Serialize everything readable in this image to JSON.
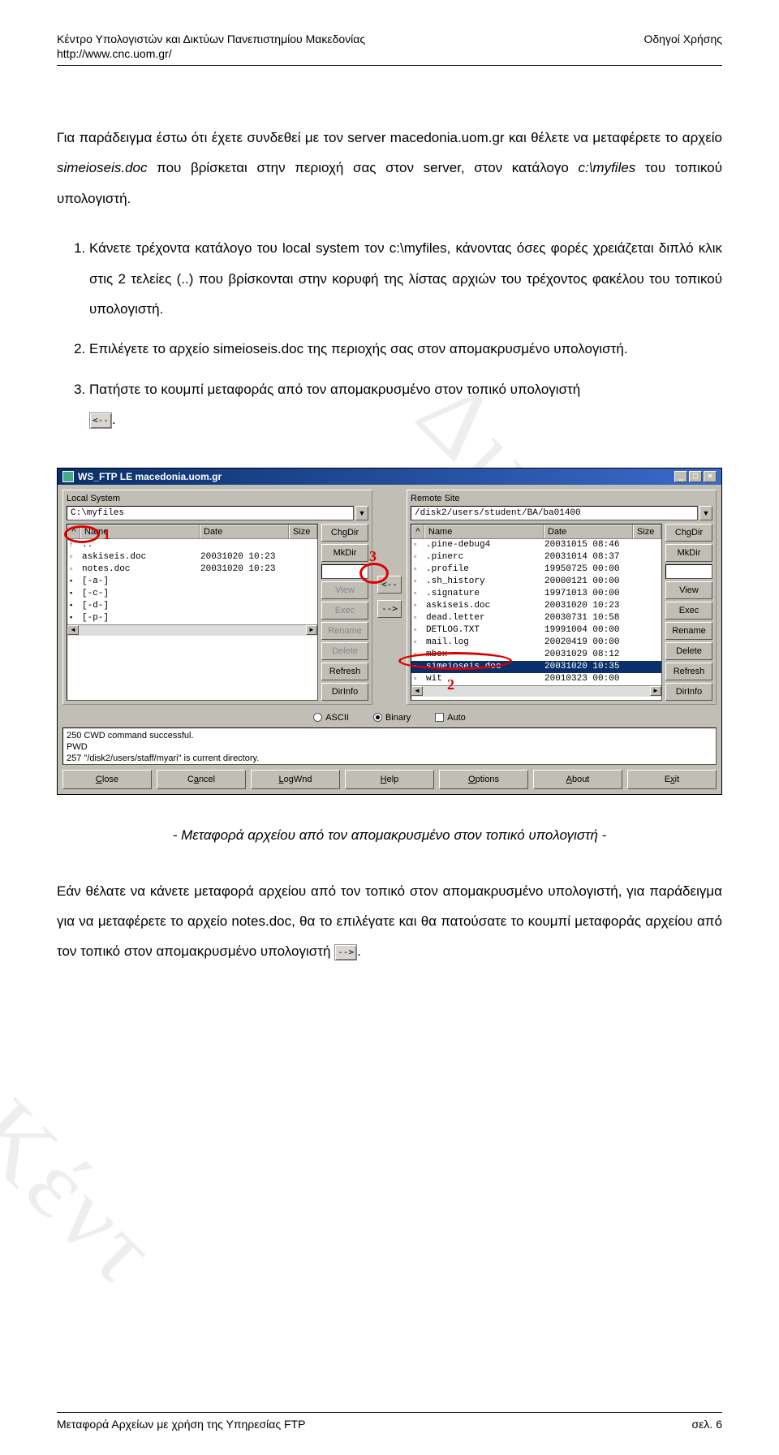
{
  "header": {
    "left": "Κέντρο Υπολογιστών και Δικτύων Πανεπιστημίου Μακεδονίας",
    "right": "Οδηγοί Χρήσης",
    "url": "http://www.cnc.uom.gr/"
  },
  "intro": {
    "p1a": "Για παράδειγμα έστω ότι έχετε συνδεθεί με τον server macedonia.uom.gr και θέλετε να μεταφέρετε το αρχείο ",
    "p1_file": "simeioseis.doc",
    "p1b": " που βρίσκεται στην περιοχή σας στον server, στον κατάλογο ",
    "p1_path": "c:\\myfiles",
    "p1c": " του τοπικού υπολογιστή."
  },
  "steps": {
    "s1a": "Κάνετε τρέχοντα κατάλογο του local system τον ",
    "s1_path": "c:\\myfiles",
    "s1b": ", κάνοντας όσες φορές χρειάζεται διπλό κλικ στις 2 τελείες (..) που βρίσκονται στην κορυφή της λίστας αρχιών του τρέχοντος φακέλου του τοπικού υπολογιστή.",
    "s2a": "Επιλέγετε το αρχείο ",
    "s2_file": "simeioseis.doc",
    "s2b": " της περιοχής σας στον απομακρυσμένο υπολογιστή.",
    "s3": "Πατήστε το κουμπί μεταφοράς από τον απομακρυσμένο στον τοπικό υπολογιστή ",
    "s3_btn": "<--",
    "s3_end": "."
  },
  "ftp": {
    "title": "WS_FTP LE macedonia.uom.gr",
    "local_label": "Local System",
    "remote_label": "Remote Site",
    "local_path": "C:\\myfiles",
    "remote_path": "/disk2/users/student/BA/ba01400",
    "cols": {
      "name": "Name",
      "date": "Date",
      "size": "Size"
    },
    "local_files": [
      {
        "icon": "↑",
        "name": "..",
        "date": "",
        "size": ""
      },
      {
        "icon": "▫",
        "name": "askiseis.doc",
        "date": "20031020 10:23",
        "size": ""
      },
      {
        "icon": "▫",
        "name": "notes.doc",
        "date": "20031020 10:23",
        "size": ""
      },
      {
        "icon": "▪",
        "name": "[-a-]",
        "date": "",
        "size": ""
      },
      {
        "icon": "▪",
        "name": "[-c-]",
        "date": "",
        "size": ""
      },
      {
        "icon": "▪",
        "name": "[-d-]",
        "date": "",
        "size": ""
      },
      {
        "icon": "▪",
        "name": "[-p-]",
        "date": "",
        "size": ""
      }
    ],
    "remote_files": [
      {
        "icon": "▫",
        "name": ".pine-debug4",
        "date": "20031015 08:46",
        "size": ""
      },
      {
        "icon": "▫",
        "name": ".pinerc",
        "date": "20031014 08:37",
        "size": ""
      },
      {
        "icon": "▫",
        "name": ".profile",
        "date": "19950725 00:00",
        "size": ""
      },
      {
        "icon": "▫",
        "name": ".sh_history",
        "date": "20000121 00:00",
        "size": ""
      },
      {
        "icon": "▫",
        "name": ".signature",
        "date": "19971013 00:00",
        "size": ""
      },
      {
        "icon": "▫",
        "name": "askiseis.doc",
        "date": "20031020 10:23",
        "size": ""
      },
      {
        "icon": "▫",
        "name": "dead.letter",
        "date": "20030731 10:58",
        "size": ""
      },
      {
        "icon": "▫",
        "name": "DETLOG.TXT",
        "date": "19991004 00:00",
        "size": ""
      },
      {
        "icon": "▫",
        "name": "mail.log",
        "date": "20020419 00:00",
        "size": ""
      },
      {
        "icon": "▫",
        "name": "mbox",
        "date": "20031029 08:12",
        "size": ""
      },
      {
        "icon": "▫",
        "name": "simeioseis.doc",
        "date": "20031020 10:35",
        "size": "",
        "selected": true
      },
      {
        "icon": "▫",
        "name": "wit",
        "date": "20010323 00:00",
        "size": ""
      }
    ],
    "side_buttons": {
      "chgdir": "ChgDir",
      "mkdir": "MkDir",
      "view": "View",
      "exec": "Exec",
      "rename": "Rename",
      "delete": "Delete",
      "refresh": "Refresh",
      "dirinfo": "DirInfo"
    },
    "transfer": {
      "left": "<--",
      "right": "-->"
    },
    "modes": {
      "ascii": "ASCII",
      "binary": "Binary",
      "auto": "Auto"
    },
    "status": [
      "250 CWD command successful.",
      "PWD",
      "257 \"/disk2/users/staff/myari\" is current directory."
    ],
    "bottom": {
      "close": "Close",
      "cancel": "Cancel",
      "logwnd": "LogWnd",
      "help": "Help",
      "options": "Options",
      "about": "About",
      "exit": "Exit"
    }
  },
  "annotations": {
    "a1": "1",
    "a2": "2",
    "a3": "3"
  },
  "caption": "- Μεταφορά αρχείου από τον απομακρυσμένο στον τοπικό υπολογιστή -",
  "closing": {
    "p1": "Εάν θέλατε να κάνετε μεταφορά αρχείου από τον τοπικό στον απομακρυσμένο υπολογιστή, για παράδειγμα για να μεταφέρετε το αρχείο notes.doc, θα το επιλέγατε και θα πατούσατε το κουμπί μεταφοράς αρχείου από τον τοπικό στον απομακρυσμένο υπολογιστή ",
    "btn": "-->",
    "end": "."
  },
  "footer": {
    "left": "Μεταφορά Αρχείων με χρήση της Υπηρεσίας FTP",
    "right": "σελ. 6"
  },
  "watermark": {
    "text1": "Δικτύων",
    "text2": "Κέντ"
  }
}
